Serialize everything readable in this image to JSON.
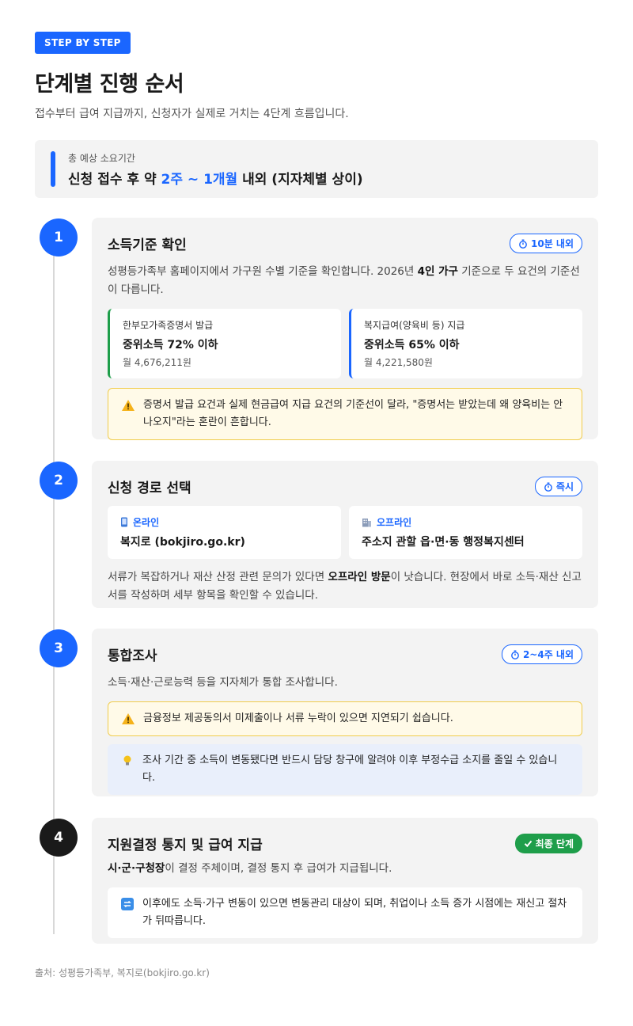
{
  "header": {
    "badge": "STEP BY STEP",
    "title": "단계별 진행 순서",
    "subtitle": "접수부터 급여 지급까지, 신청자가 실제로 거치는 4단계 흐름입니다."
  },
  "summary": {
    "label": "총 예상 소요기간",
    "prefix": "신청 접수 후 약 ",
    "accent": "2주 ~ 1개월",
    "suffix": " 내외 (지자체별 상이)"
  },
  "steps": [
    {
      "number": "1",
      "title": "소득기준 확인",
      "time": "10분 내외",
      "desc_a": "성평등가족부 홈페이지에서 가구원 수별 기준을 확인합니다. 2026년 ",
      "desc_bold": "4인 가구",
      "desc_b": " 기준으로 두 요건의 기준선이 다릅니다.",
      "boxes": [
        {
          "label": "한부모가족증명서 발급",
          "value": "중위소득 72% 이하",
          "sub": "월 4,676,211원"
        },
        {
          "label": "복지급여(양육비 등) 지급",
          "value": "중위소득 65% 이하",
          "sub": "월 4,221,580원"
        }
      ],
      "warning": "증명서 발급 요건과 실제 현금급여 지급 요건의 기준선이 달라, \"증명서는 받았는데 왜 양육비는 안 나오지\"라는 혼란이 흔합니다."
    },
    {
      "number": "2",
      "title": "신청 경로 선택",
      "time": "즉시",
      "boxes": [
        {
          "label": "온라인",
          "value": "복지로 (bokjiro.go.kr)"
        },
        {
          "label": "오프라인",
          "value": "주소지 관할 읍·면·동 행정복지센터"
        }
      ],
      "desc_a": "서류가 복잡하거나 재산 산정 관련 문의가 있다면 ",
      "desc_bold": "오프라인 방문",
      "desc_b": "이 낫습니다. 현장에서 바로 소득·재산 신고서를 작성하며 세부 항목을 확인할 수 있습니다."
    },
    {
      "number": "3",
      "title": "통합조사",
      "time": "2~4주 내외",
      "desc": "소득·재산·근로능력 등을 지자체가 통합 조사합니다.",
      "warning": "금융정보 제공동의서 미제출이나 서류 누락이 있으면 지연되기 쉽습니다.",
      "tip": "조사 기간 중 소득이 변동됐다면 반드시 담당 창구에 알려야 이후 부정수급 소지를 줄일 수 있습니다."
    },
    {
      "number": "4",
      "title": "지원결정 통지 및 급여 지급",
      "time": "최종 단계",
      "desc_bold": "시·군·구청장",
      "desc_b": "이 결정 주체이며, 결정 통지 후 급여가 지급됩니다.",
      "info": "이후에도 소득·가구 변동이 있으면 변동관리 대상이 되며, 취업이나 소득 증가 시점에는 재신고 절차가 뒤따릅니다."
    }
  ],
  "source": "출처: 성평등가족부, 복지로(bokjiro.go.kr)",
  "colors": {
    "accent": "#1a66ff",
    "green": "#1e9e4a",
    "dark": "#1a1a1a",
    "warn_bg": "#fffae8",
    "warn_border": "#f0cc4c",
    "note_bg": "#e9effb"
  },
  "icons": [
    "stopwatch-icon",
    "warning-icon",
    "mobile-phone-icon",
    "building-icon",
    "lightbulb-icon",
    "repeat-icon",
    "check-icon"
  ]
}
